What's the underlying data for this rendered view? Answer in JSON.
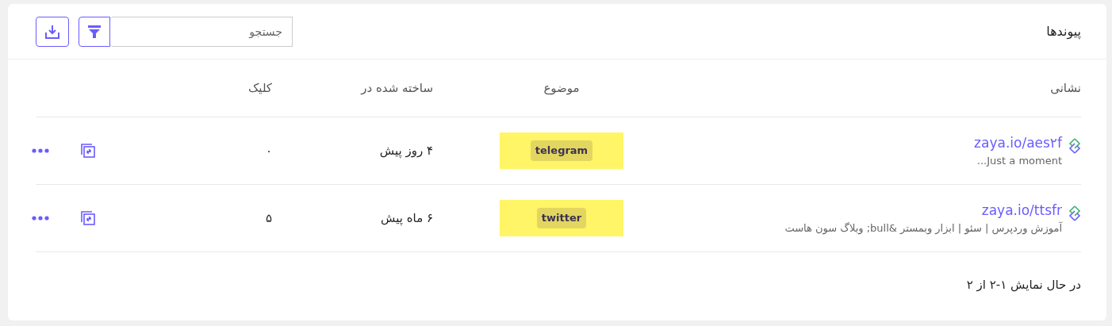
{
  "header": {
    "title": "پیوندها",
    "search": {
      "placeholder": "جستجو"
    }
  },
  "table": {
    "columns": [
      "نشانی",
      "موضوع",
      "ساخته شده در",
      "کلیک"
    ],
    "rows": [
      {
        "url": "zaya.io/aes۲f",
        "page_title": "Just a moment...",
        "tag": "telegram",
        "created": "۴ روز پیش",
        "clicks": "۰"
      },
      {
        "url": "zaya.io/ttsfr",
        "page_title": "آموزش وردپرس | سئو | ابزار وبمستر &bull; وبلاگ سون هاست",
        "tag": "twitter",
        "created": "۶ ماه پیش",
        "clicks": "۵"
      }
    ]
  },
  "footer": "در حال نمایش ۱-۲ از ۲"
}
